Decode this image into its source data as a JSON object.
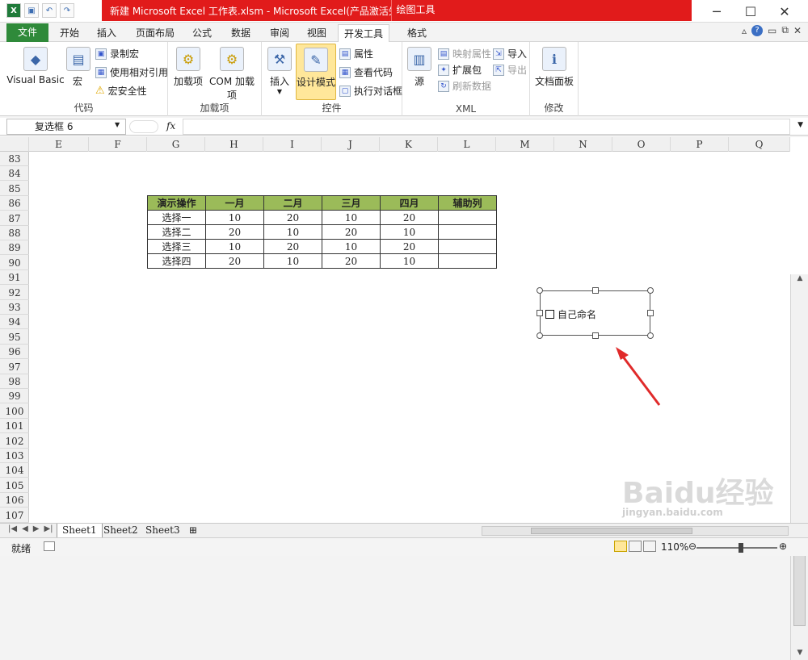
{
  "window": {
    "title": "新建 Microsoft Excel 工作表.xlsm - Microsoft Excel(产品激活失败)",
    "context_tab": "绘图工具",
    "accent_red": "#e11b1b",
    "file_green": "#2f8a3a"
  },
  "qat": {
    "excel_icon": "X",
    "save": "💾",
    "undo": "↶",
    "redo": "↷"
  },
  "tabs": [
    "文件",
    "开始",
    "插入",
    "页面布局",
    "公式",
    "数据",
    "审阅",
    "视图",
    "开发工具",
    "格式"
  ],
  "ribbon": {
    "groups": {
      "code": {
        "label": "代码",
        "visual_basic": "Visual Basic",
        "macro": "宏",
        "record_macro": "录制宏",
        "relative_ref": "使用相对引用",
        "macro_security": "宏安全性"
      },
      "addins": {
        "label": "加载项",
        "addins": "加载项",
        "com_addins": "COM 加载项"
      },
      "controls": {
        "label": "控件",
        "insert": "插入",
        "design_mode": "设计模式",
        "properties": "属性",
        "view_code": "查看代码",
        "run_dialog": "执行对话框"
      },
      "xml": {
        "label": "XML",
        "source": "源",
        "map_props": "映射属性",
        "expansion": "扩展包",
        "refresh": "刷新数据",
        "import": "导入",
        "export": "导出"
      },
      "modify": {
        "label": "修改",
        "doc_panel": "文档面板"
      }
    }
  },
  "formula_bar": {
    "name_box": "复选框 6",
    "fx": "fx",
    "content": ""
  },
  "columns": [
    "E",
    "F",
    "G",
    "H",
    "I",
    "J",
    "K",
    "L",
    "M",
    "N",
    "O",
    "P",
    "Q"
  ],
  "rows": [
    "83",
    "84",
    "85",
    "86",
    "87",
    "88",
    "89",
    "90",
    "91",
    "92",
    "93",
    "94",
    "95",
    "96",
    "97",
    "98",
    "99",
    "100",
    "101",
    "102",
    "103",
    "104",
    "105",
    "106",
    "107"
  ],
  "table": {
    "headers": [
      "演示操作",
      "一月",
      "二月",
      "三月",
      "四月",
      "辅助列"
    ],
    "rows": [
      [
        "选择一",
        "10",
        "20",
        "10",
        "20",
        ""
      ],
      [
        "选择二",
        "20",
        "10",
        "20",
        "10",
        ""
      ],
      [
        "选择三",
        "10",
        "20",
        "10",
        "20",
        ""
      ],
      [
        "选择四",
        "20",
        "10",
        "20",
        "10",
        ""
      ]
    ],
    "header_color": "#9bbb59"
  },
  "checkbox": {
    "label": "自己命名"
  },
  "sheets": [
    "Sheet1",
    "Sheet2",
    "Sheet3"
  ],
  "status": {
    "ready": "就绪",
    "zoom": "110%"
  },
  "watermark": {
    "brand": "Baidu经验",
    "url": "jingyan.baidu.com"
  }
}
